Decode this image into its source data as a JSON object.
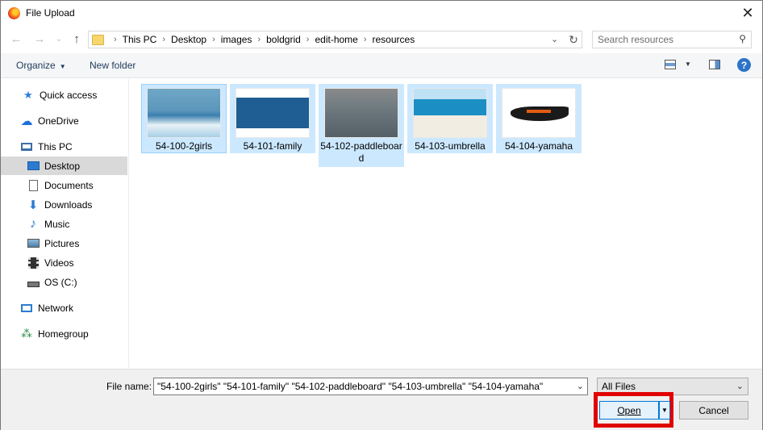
{
  "window": {
    "title": "File Upload",
    "close_glyph": "✕"
  },
  "nav_buttons": {
    "back": "←",
    "forward": "→",
    "recent": "⌄",
    "up": "↑"
  },
  "address": {
    "crumbs": [
      "This PC",
      "Desktop",
      "images",
      "boldgrid",
      "edit-home",
      "resources"
    ],
    "separator": "›"
  },
  "search": {
    "placeholder": "Search resources"
  },
  "toolbar": {
    "organize": "Organize",
    "new_folder": "New folder",
    "help": "?"
  },
  "sidebar": {
    "items": [
      {
        "label": "Quick access",
        "icon": "star-icon",
        "glyph": "★",
        "color": "#2f7ed8"
      },
      {
        "label": "OneDrive",
        "icon": "cloud-icon",
        "glyph": "☁",
        "color": "#1e6fd9"
      },
      {
        "label": "This PC",
        "icon": "computer-icon",
        "glyph": "🖳",
        "color": "#3d6ea5"
      },
      {
        "label": "Desktop",
        "icon": "desktop-icon",
        "glyph": "▭",
        "color": "#2b7bd1"
      },
      {
        "label": "Documents",
        "icon": "document-icon",
        "glyph": "🗎",
        "color": "#4b4b4b"
      },
      {
        "label": "Downloads",
        "icon": "download-icon",
        "glyph": "⬇",
        "color": "#2b7bd1"
      },
      {
        "label": "Music",
        "icon": "music-icon",
        "glyph": "♪",
        "color": "#2b7bd1"
      },
      {
        "label": "Pictures",
        "icon": "pictures-icon",
        "glyph": "▣",
        "color": "#4d7ea8"
      },
      {
        "label": "Videos",
        "icon": "video-icon",
        "glyph": "▦",
        "color": "#333333"
      },
      {
        "label": "OS (C:)",
        "icon": "drive-icon",
        "glyph": "▬",
        "color": "#555555"
      },
      {
        "label": "Network",
        "icon": "network-icon",
        "glyph": "🖧",
        "color": "#2b7bd1"
      },
      {
        "label": "Homegroup",
        "icon": "homegroup-icon",
        "glyph": "⁂",
        "color": "#2a8f4b"
      }
    ]
  },
  "files": [
    {
      "name": "54-100-2girls"
    },
    {
      "name": "54-101-family"
    },
    {
      "name": "54-102-paddleboard"
    },
    {
      "name": "54-103-umbrella"
    },
    {
      "name": "54-104-yamaha"
    }
  ],
  "footer": {
    "file_name_label": "File name:",
    "file_name_value": "\"54-100-2girls\" \"54-101-family\" \"54-102-paddleboard\" \"54-103-umbrella\" \"54-104-yamaha\"",
    "file_type": "All Files",
    "open_label": "Open",
    "cancel_label": "Cancel"
  }
}
